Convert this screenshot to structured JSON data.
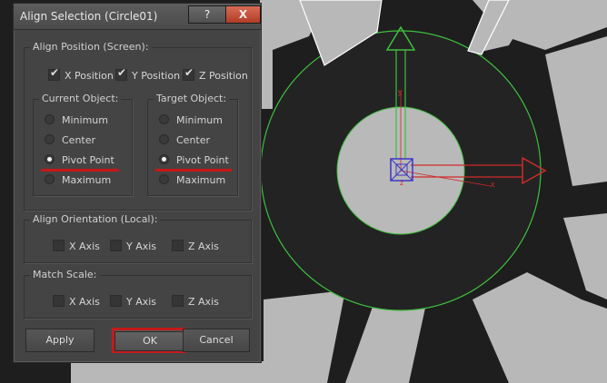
{
  "dialog": {
    "title": "Align Selection (Circle01)",
    "help_label": "?",
    "close_label": "X",
    "align_position": {
      "label": "Align Position (Screen):",
      "x": "X Position",
      "y": "Y Position",
      "z": "Z Position",
      "current_object": {
        "label": "Current Object:",
        "options": [
          "Minimum",
          "Center",
          "Pivot Point",
          "Maximum"
        ],
        "selected": "Pivot Point"
      },
      "target_object": {
        "label": "Target Object:",
        "options": [
          "Minimum",
          "Center",
          "Pivot Point",
          "Maximum"
        ],
        "selected": "Pivot Point"
      }
    },
    "align_orientation": {
      "label": "Align Orientation (Local):",
      "x": "X Axis",
      "y": "Y Axis",
      "z": "Z Axis"
    },
    "match_scale": {
      "label": "Match Scale:",
      "x": "X Axis",
      "y": "Y Axis",
      "z": "Z Axis"
    },
    "buttons": {
      "apply": "Apply",
      "ok": "OK",
      "cancel": "Cancel"
    }
  },
  "viewport": {
    "axis_x": "x",
    "axis_y": "y",
    "axis_z": "z"
  },
  "colors": {
    "highlight": "#c41a1a",
    "gizmo_green": "#3fbf3f",
    "gizmo_red": "#d22a2a"
  }
}
